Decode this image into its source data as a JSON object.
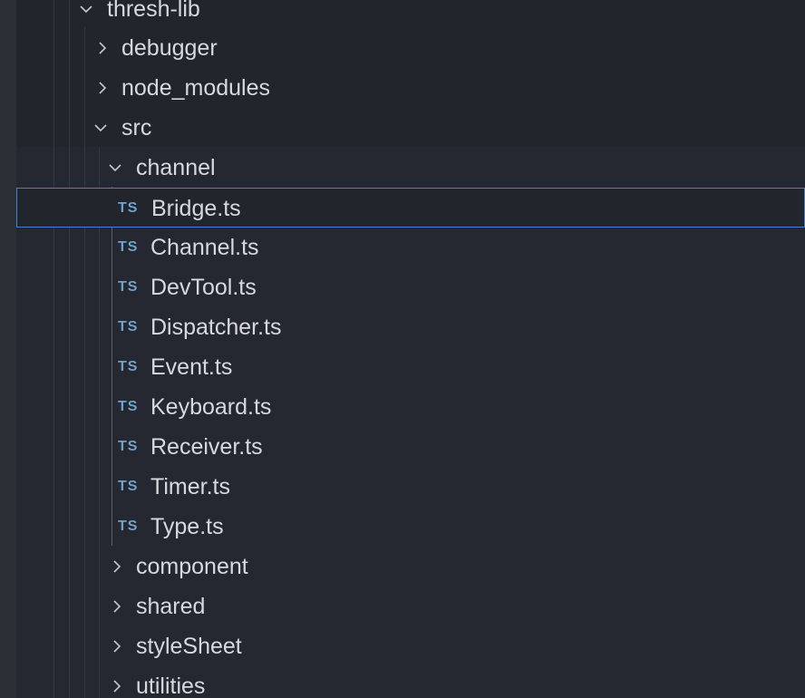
{
  "explorer": {
    "folders": {
      "thresh_lib": "thresh-lib",
      "debugger": "debugger",
      "node_modules": "node_modules",
      "src": "src",
      "channel": "channel",
      "component": "component",
      "shared": "shared",
      "styleSheet": "styleSheet",
      "utilities": "utilities"
    },
    "file_badge": "TS",
    "channel_files": [
      "Bridge.ts",
      "Channel.ts",
      "DevTool.ts",
      "Dispatcher.ts",
      "Event.ts",
      "Keyboard.ts",
      "Receiver.ts",
      "Timer.ts",
      "Type.ts"
    ],
    "selected_file": "Bridge.ts"
  },
  "colors": {
    "background": "#22252b",
    "text": "#d6d9de",
    "ts_badge": "#6ea2cc",
    "selection_border": "#4a7fd6"
  }
}
